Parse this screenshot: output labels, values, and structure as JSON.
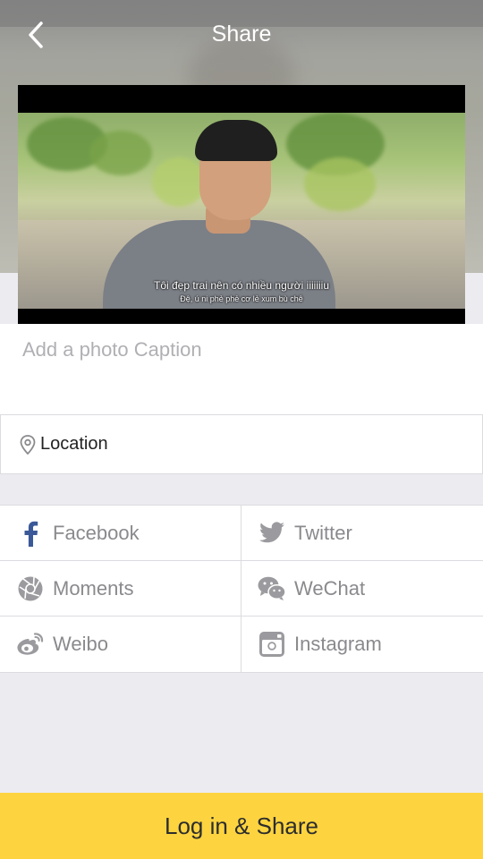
{
  "header": {
    "title": "Share"
  },
  "photo": {
    "subtitle_line1": "Tôi đẹp trai nên có nhiều người iiiiiiiu",
    "subtitle_line2": "Đệ, ú ni phẻ phẻ cơ lẻ xum bù chê"
  },
  "caption": {
    "placeholder": "Add a photo Caption",
    "value": ""
  },
  "location": {
    "label": "Location",
    "icon": "location-pin-icon"
  },
  "share_targets": [
    {
      "label": "Facebook",
      "icon": "facebook-icon",
      "color": "#3b5998"
    },
    {
      "label": "Twitter",
      "icon": "twitter-icon",
      "color": "#9b9b9f"
    },
    {
      "label": "Moments",
      "icon": "moments-icon",
      "color": "#9b9b9f"
    },
    {
      "label": "WeChat",
      "icon": "wechat-icon",
      "color": "#9b9b9f"
    },
    {
      "label": "Weibo",
      "icon": "weibo-icon",
      "color": "#9b9b9f"
    },
    {
      "label": "Instagram",
      "icon": "instagram-icon",
      "color": "#9b9b9f"
    }
  ],
  "footer": {
    "share_button_label": "Log in & Share",
    "accent_color": "#fdd43f"
  }
}
